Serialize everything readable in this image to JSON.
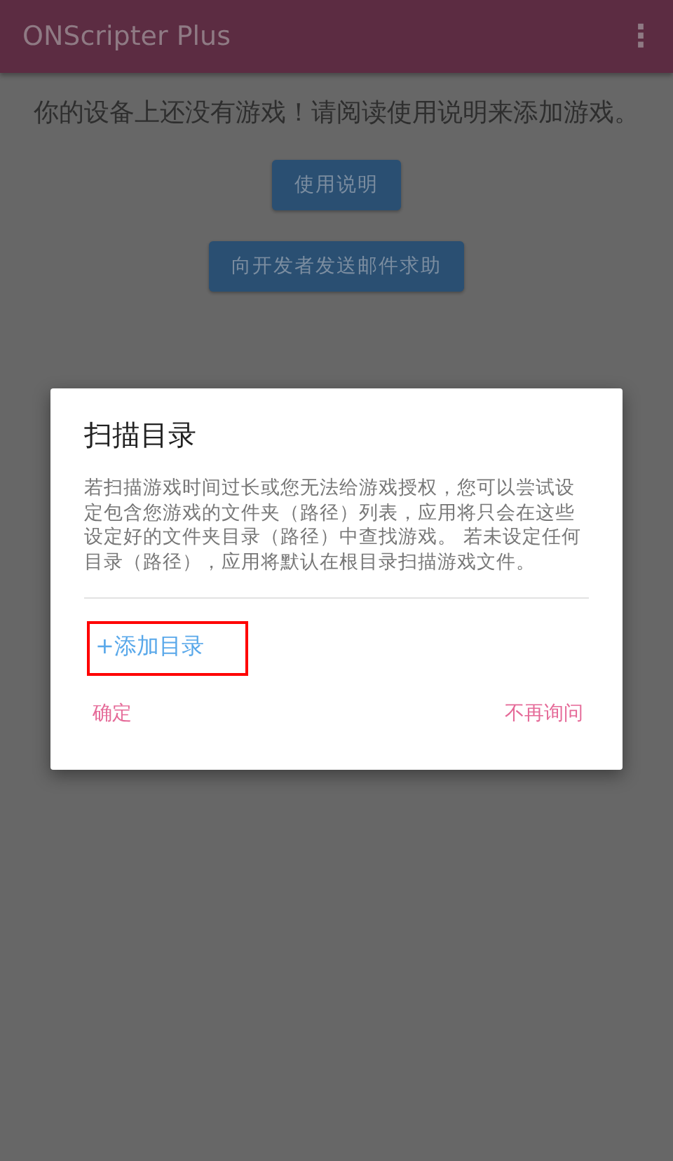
{
  "app_bar": {
    "title": "ONScripter Plus",
    "menu_icon": "⋮"
  },
  "empty_message": "你的设备上还没有游戏！请阅读使用说明来添加游戏。",
  "buttons": [
    "使用说明",
    "向开发者发送邮件求助"
  ],
  "dialog": {
    "title": "扫描目录",
    "message": "若扫描游戏时间过长或您无法给游戏授权，您可以尝试设定包含您游戏的文件夹（路径）列表，应用将只会在这些设定好的文件夹目录（路径）中查找游戏。 若未设定任何目录（路径），应用将默认在根目录扫描游戏文件。",
    "add_directory": {
      "label": "+添加目录",
      "highlighted": true
    },
    "actions": [
      {
        "label": "确定",
        "kind": "left"
      },
      {
        "label": "不再询问",
        "kind": "right"
      }
    ]
  }
}
